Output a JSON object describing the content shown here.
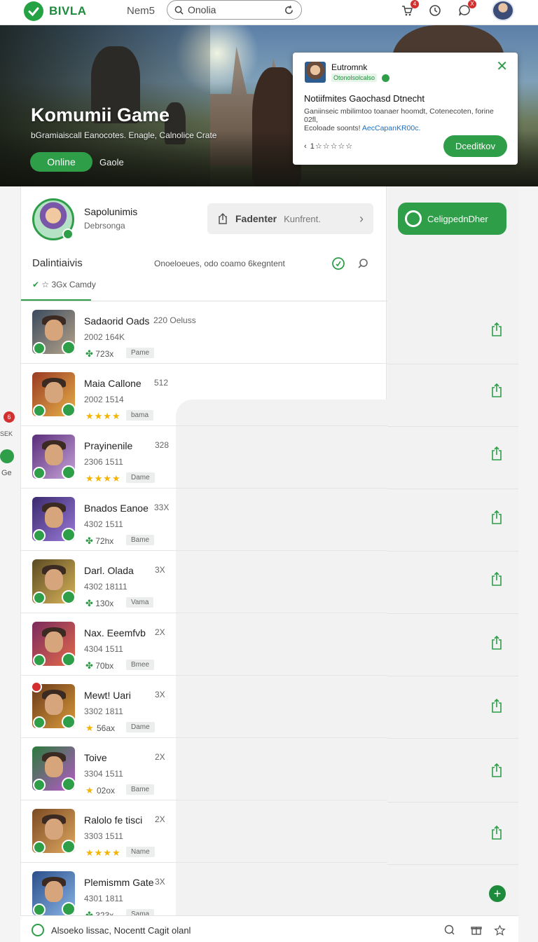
{
  "topbar": {
    "logo_text": "BIVLA",
    "nav_link": "Nem5",
    "search_value": "Onolia",
    "cart_badge": "4",
    "chat_badge": "X"
  },
  "banner": {
    "title": "Komumii Game",
    "subtitle": "bGramiaiscall Eanocotes. Enagle, Calnolice Crate",
    "online_button": "Online",
    "link": "Gaole"
  },
  "notification": {
    "name": "Eutromnk",
    "tag": "Otonolsolcalso",
    "title": "Notiifmites Gaochasd Dtnecht",
    "body": "Ganiinseic mbilimtoo toanaer hoomdt, Cotenecoten, forine 02fl,",
    "body2": "Ecoloade soonts!",
    "body_link": "AecCapanKR00c.",
    "rating": "1☆☆☆☆☆",
    "button": "Dceditkov"
  },
  "left_strip": {
    "badge": "6",
    "label": "SEK",
    "label2": "Ge"
  },
  "profile": {
    "name": "Sapolunimis",
    "subtitle": "Debrsonga",
    "fadender_bold": "Fadenter",
    "fadender_text": "Kunfrent."
  },
  "section": {
    "title": "Dalintiaivis",
    "meta": "Onoeloeues, odo coamo 6kegntent",
    "filter": "☆ 3Gx Camdy"
  },
  "cta": {
    "label": "CeligpednDher"
  },
  "games": [
    {
      "title": "Sadaorid Oads",
      "count": "220 Oeluss",
      "id": "2002 164K",
      "stat": "723x",
      "stat_type": "clover",
      "chip": "Pame",
      "colors": [
        "#3a4a5e",
        "#b7a48a"
      ]
    },
    {
      "title": "Maia Callone",
      "count": "512",
      "id": "2002 1514",
      "stat": "★★★★",
      "stat_type": "stars",
      "chip": "bama",
      "colors": [
        "#9a3a22",
        "#e7b14a"
      ]
    },
    {
      "title": "Prayinenile",
      "count": "328",
      "id": "2306 1511",
      "stat": "★★★★",
      "stat_type": "stars",
      "chip": "Dame",
      "colors": [
        "#5a2d7a",
        "#c6a4d8"
      ]
    },
    {
      "title": "Bnados Eanoe",
      "count": "33X",
      "id": "4302 1511",
      "stat": "72hx",
      "stat_type": "clover",
      "chip": "Bame",
      "colors": [
        "#3a2a6e",
        "#9a7ad8"
      ]
    },
    {
      "title": "Darl. Olada",
      "count": "3X",
      "id": "4302 18111",
      "stat": "130x",
      "stat_type": "clover",
      "chip": "Vama",
      "colors": [
        "#5b4a22",
        "#d8b45a"
      ]
    },
    {
      "title": "Nax. Eeemfvb",
      "count": "2X",
      "id": "4304 1511",
      "stat": "70bx",
      "stat_type": "clover",
      "chip": "Bmee",
      "colors": [
        "#7a2a5e",
        "#e46a4a"
      ]
    },
    {
      "title": "Mewt! Uari",
      "count": "3X",
      "id": "3302 1811",
      "stat": "56ax",
      "stat_type": "star",
      "chip": "Dame",
      "colors": [
        "#6a3a1a",
        "#d99a3a"
      ]
    },
    {
      "title": "Toive",
      "count": "2X",
      "id": "3304 1511",
      "stat": "02ox",
      "stat_type": "star",
      "chip": "Bame",
      "colors": [
        "#2a7a3a",
        "#b85ac8"
      ]
    },
    {
      "title": "Ralolo fe tisci",
      "count": "2X",
      "id": "3303 1511",
      "stat": "★★★★",
      "stat_type": "stars",
      "chip": "Name",
      "colors": [
        "#7a4a22",
        "#e0a860"
      ]
    },
    {
      "title": "Plemismm Gate",
      "count": "3X",
      "id": "4301 1811",
      "stat": "323x",
      "stat_type": "clover",
      "chip": "Sama",
      "colors": [
        "#2a4e8a",
        "#8ab4e6"
      ]
    }
  ],
  "bottombar": {
    "text": "Alsoeko lissac, Nocentt Cagit olanl"
  }
}
